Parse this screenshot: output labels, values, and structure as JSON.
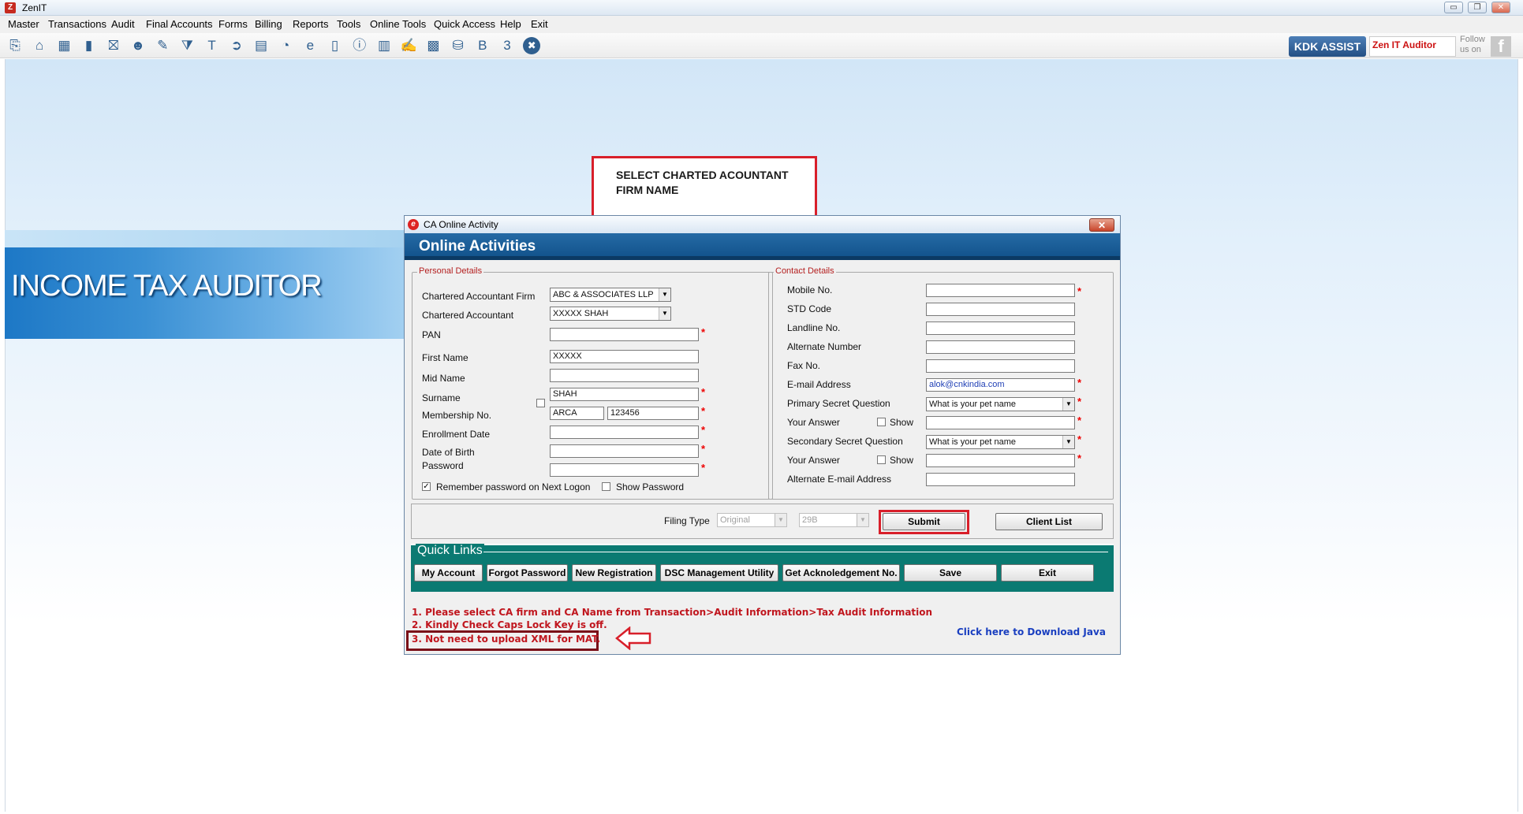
{
  "window": {
    "title": "ZenIT",
    "buttons": [
      "▭",
      "❐",
      "✕"
    ]
  },
  "menu": [
    "Master",
    "Transactions",
    "Audit",
    "Final Accounts",
    "Forms",
    "Billing",
    "Reports",
    "Tools",
    "Online Tools",
    "Quick Access",
    "Help",
    "Exit"
  ],
  "toolbar": {
    "kdk_assist": "KDK ASSIST",
    "zen_it_auditor": "Zen IT Auditor",
    "follow_us": "Follow us on",
    "facebook": "f",
    "icons": [
      "open-icon",
      "home-icon",
      "building-icon",
      "chart-icon",
      "gift-icon",
      "users-icon",
      "pin-icon",
      "filter-icon",
      "tax-icon",
      "forward-icon",
      "calculator-icon",
      "pie-icon",
      "epay-icon",
      "book-icon",
      "info-icon",
      "report-icon",
      "edit-doc-icon",
      "calendar-icon",
      "folder-icon",
      "bs-icon",
      "3cd-icon",
      "close-circle-icon"
    ],
    "icon_glyphs": [
      "⎘",
      "⌂",
      "▦",
      "▮",
      "⛝",
      "☻",
      "✎",
      "⧩",
      "T",
      "➲",
      "▤",
      "◔",
      "e",
      "▯",
      "ⓘ",
      "▥",
      "✍",
      "▩",
      "⛁",
      "B",
      "3",
      "✖"
    ]
  },
  "banner": {
    "text": "INCOME TAX AUDITOR"
  },
  "callout": {
    "text": "SELECT CHARTED ACOUNTANT FIRM NAME"
  },
  "dialog": {
    "title": "CA Online Activity",
    "heading": "Online Activities",
    "personal": {
      "legend": "Personal Details",
      "ca_firm_label": "Chartered Accountant Firm",
      "ca_firm_value": "ABC & ASSOCIATES LLP",
      "ca_label": "Chartered Accountant",
      "ca_value": "XXXXX SHAH",
      "pan_label": "PAN",
      "pan_value": "",
      "first_name_label": "First Name",
      "first_name_value": "XXXXX",
      "mid_name_label": "Mid Name",
      "mid_name_value": "",
      "surname_label": "Surname",
      "surname_value": "SHAH",
      "membership_label": "Membership No.",
      "membership_prefix": "ARCA",
      "membership_value": "123456",
      "enrollment_label": "Enrollment Date",
      "enrollment_value": "",
      "dob_label": "Date of Birth",
      "dob_value": "",
      "password_label": "Password",
      "password_value": "",
      "remember_label": "Remember password on Next Logon",
      "show_password_label": "Show Password"
    },
    "contact": {
      "legend": "Contact Details",
      "mobile_label": "Mobile No.",
      "std_label": "STD Code",
      "landline_label": "Landline No.",
      "alt_number_label": "Alternate Number",
      "fax_label": "Fax No.",
      "email_label": "E-mail Address",
      "email_value": "alok@cnkindia.com",
      "primary_q_label": "Primary Secret Question",
      "primary_q_value": "What is your pet name",
      "answer_label": "Your Answer",
      "show_label": "Show",
      "secondary_q_label": "Secondary Secret Question",
      "secondary_q_value": "What is your pet name",
      "alt_email_label": "Alternate E-mail Address"
    },
    "filing": {
      "label": "Filing Type",
      "type_value": "Original",
      "form_value": "29B",
      "submit": "Submit",
      "client_list": "Client List"
    },
    "quick_links": {
      "title": "Quick Links",
      "buttons": [
        "My Account",
        "Forgot Password",
        "New Registration",
        "DSC Management Utility",
        "Get Acknoledgement No.",
        "Save",
        "Exit"
      ]
    },
    "notes": [
      "1. Please select CA firm and CA Name from Transaction>Audit Information>Tax Audit Information",
      "2. Kindly Check Caps Lock Key is off.",
      "3. Not need to upload XML for MAT."
    ],
    "java_link": "Click here to Download Java",
    "required_mark": "*"
  },
  "colors": {
    "accent_blue": "#13548d",
    "quick_links_teal": "#0b7a72",
    "annotation_red": "#d81f2a",
    "note_red": "#c0161e"
  }
}
